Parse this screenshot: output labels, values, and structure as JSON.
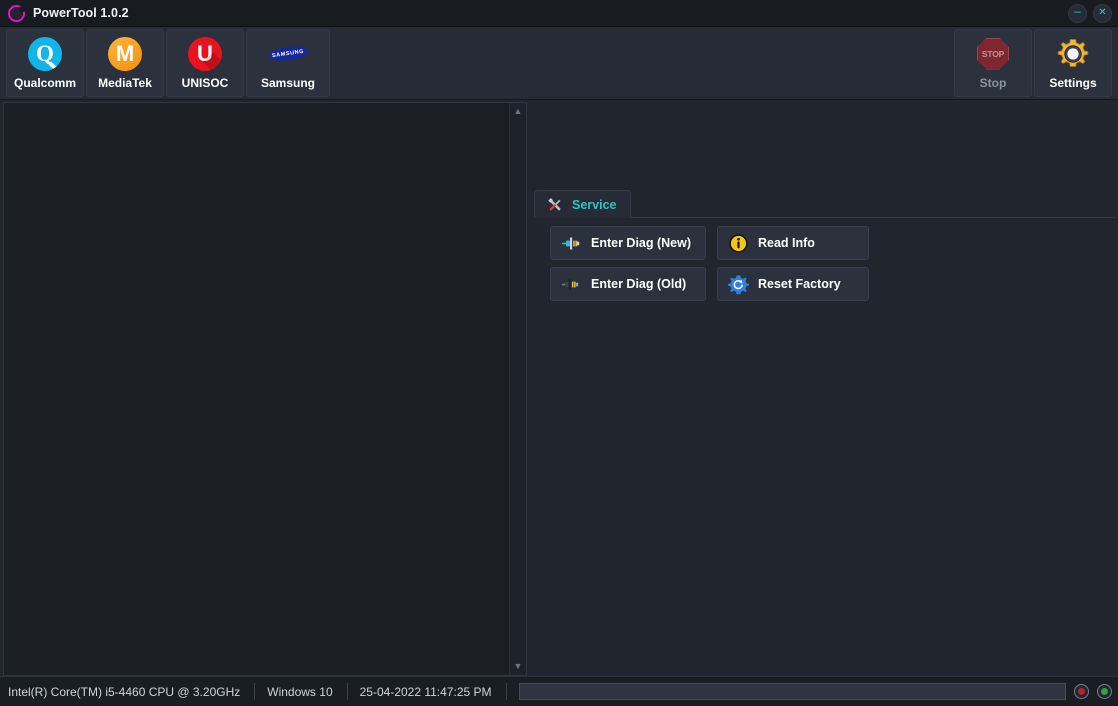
{
  "window": {
    "title": "PowerTool 1.0.2",
    "logo_icon": "powertool-ring-logo",
    "minimize_label": "–",
    "close_label": "✕",
    "accent_color": "#2fc6c0",
    "logo_color": "#d81bc8"
  },
  "toolbar": {
    "platforms": [
      {
        "label": "Qualcomm",
        "icon": "qualcomm-logo-icon",
        "glyph": "Q",
        "color": "#12b5e8",
        "enabled": true
      },
      {
        "label": "MediaTek",
        "icon": "mediatek-logo-icon",
        "glyph": "M",
        "color": "#f5900c",
        "enabled": true
      },
      {
        "label": "UNISOC",
        "icon": "unisoc-logo-icon",
        "glyph": "U",
        "color": "#e8131f",
        "enabled": true
      },
      {
        "label": "Samsung",
        "icon": "samsung-logo-icon",
        "glyph": "SAMSUNG",
        "color": "#1428a0",
        "enabled": true
      }
    ],
    "actions": [
      {
        "label": "Stop",
        "icon": "stop-octagon-icon",
        "glyph": "STOP",
        "color": "#7e2730",
        "enabled": false
      },
      {
        "label": "Settings",
        "icon": "gear-icon",
        "color": "#f5b942",
        "enabled": true
      }
    ]
  },
  "log_panel": {
    "content": "",
    "scroll_up_icon": "chevron-up-icon",
    "scroll_down_icon": "chevron-down-icon",
    "scroll_up_glyph": "▲",
    "scroll_down_glyph": "▼"
  },
  "service_panel": {
    "tabs": [
      {
        "label": "Service",
        "icon": "tools-icon",
        "active": true
      }
    ],
    "buttons": [
      {
        "label": "Enter Diag (New)",
        "icon": "connector-new-icon",
        "column": 1,
        "row": 1
      },
      {
        "label": "Read Info",
        "icon": "info-circle-icon",
        "column": 2,
        "row": 1
      },
      {
        "label": "Enter Diag (Old)",
        "icon": "connector-old-icon",
        "column": 1,
        "row": 2
      },
      {
        "label": "Reset Factory",
        "icon": "gear-refresh-icon",
        "column": 2,
        "row": 2
      }
    ]
  },
  "statusbar": {
    "cpu": "Intel(R) Core(TM) i5-4460  CPU @ 3.20GHz",
    "os": "Windows 10",
    "datetime": "25-04-2022 11:47:25 PM",
    "progress_percent": 0,
    "leds": [
      {
        "name": "red",
        "color": "#b52230",
        "on": false
      },
      {
        "name": "green",
        "color": "#2da33a",
        "on": true
      }
    ]
  }
}
